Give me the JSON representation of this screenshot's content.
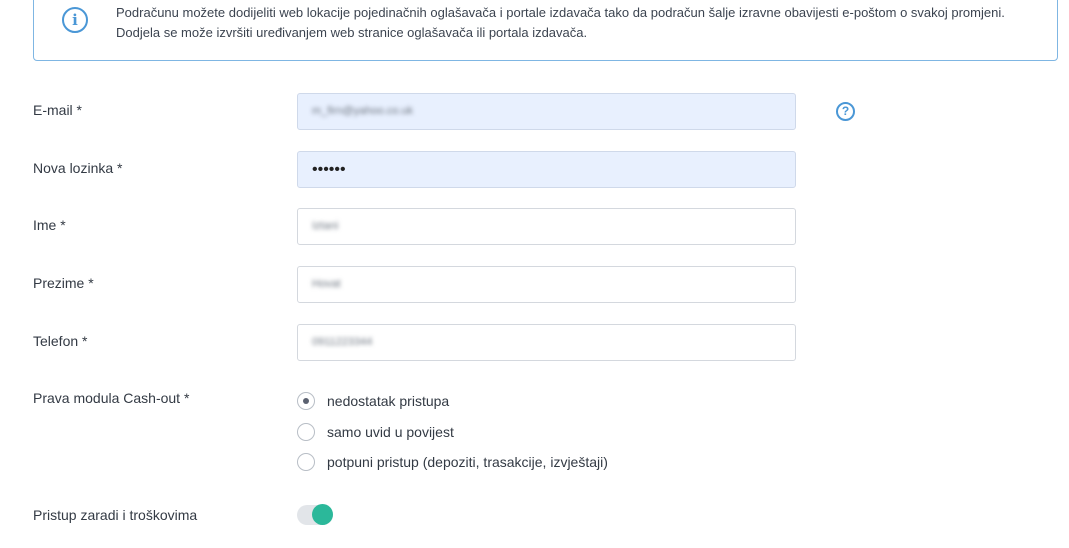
{
  "info": {
    "icon": "info-icon",
    "text": "Podračunu možete dodijeliti web lokacije pojedinačnih oglašavača i portale izdavača tako da podračun šalje izravne obavijesti e-poštom o svakoj promjeni. Dodjela se može izvršiti uređivanjem web stranice oglašavača ili portala izdavača."
  },
  "form": {
    "email": {
      "label": "E-mail *",
      "value": "m_firn@yahoo.co.uk",
      "help_icon": "question-icon"
    },
    "password": {
      "label": "Nova lozinka *",
      "value": "••••••"
    },
    "first_name": {
      "label": "Ime *",
      "value": "Iztani"
    },
    "last_name": {
      "label": "Prezime *",
      "value": "Hovat"
    },
    "phone": {
      "label": "Telefon *",
      "value": "0911223344"
    },
    "cashout": {
      "label": "Prava modula Cash-out *",
      "options": [
        {
          "label": "nedostatak pristupa",
          "checked": true
        },
        {
          "label": "samo uvid u povijest",
          "checked": false
        },
        {
          "label": "potpuni pristup (depoziti, trasakcije, izvještaji)",
          "checked": false
        }
      ]
    },
    "earnings_access": {
      "label": "Pristup zaradi i troškovima",
      "enabled": true
    }
  },
  "colors": {
    "accent": "#4a97d6",
    "toggle_on": "#2bb89a",
    "autofill": "#e8f0fe"
  }
}
